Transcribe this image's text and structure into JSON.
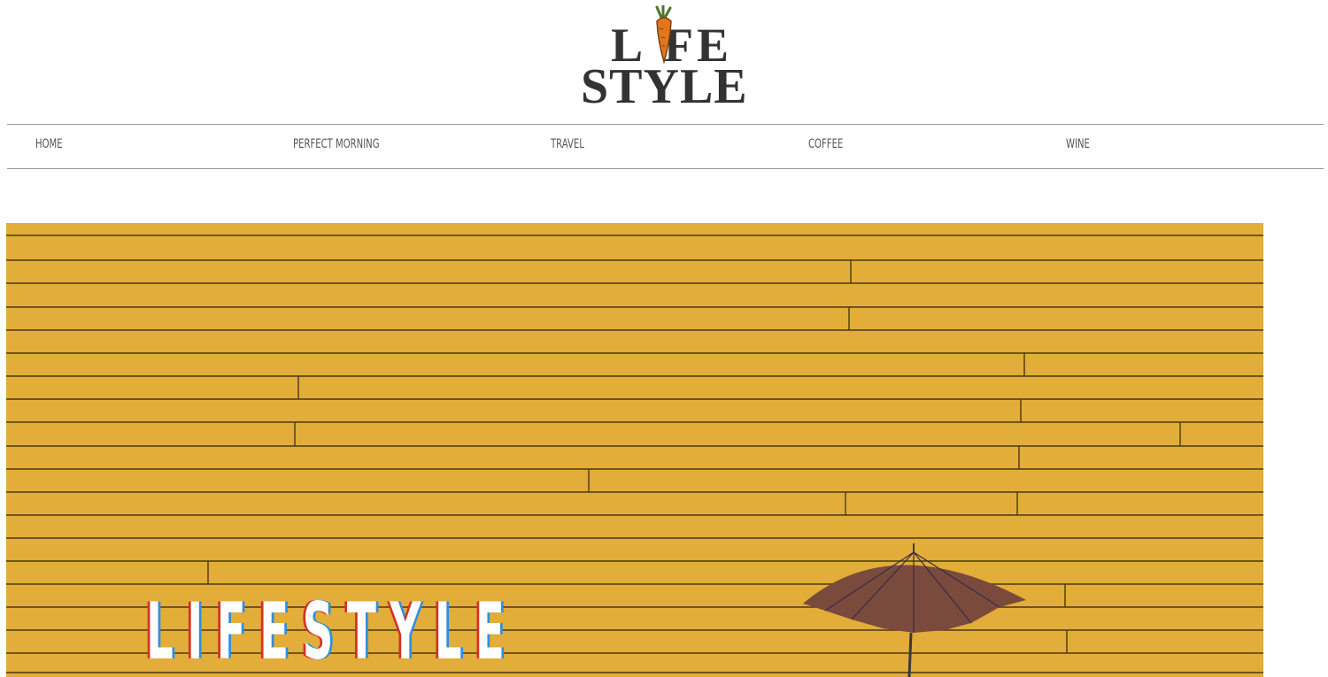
{
  "logo": {
    "line1_left": "L",
    "line1_right": "FE",
    "line2": "STYLE",
    "icon": "carrot-icon"
  },
  "nav": {
    "items": [
      {
        "label": "HOME"
      },
      {
        "label": "PERFECT MORNING"
      },
      {
        "label": "TRAVEL"
      },
      {
        "label": "COFFEE"
      },
      {
        "label": "WINE"
      }
    ]
  },
  "hero": {
    "title": "LIFESTYLE",
    "image": "yellow-wooden-wall-with-brown-umbrella",
    "colors": {
      "wall": "#e2ad38",
      "title_red": "#d4312a",
      "title_blue": "#2f8fe0",
      "umbrella": "#7a4a3c"
    }
  }
}
